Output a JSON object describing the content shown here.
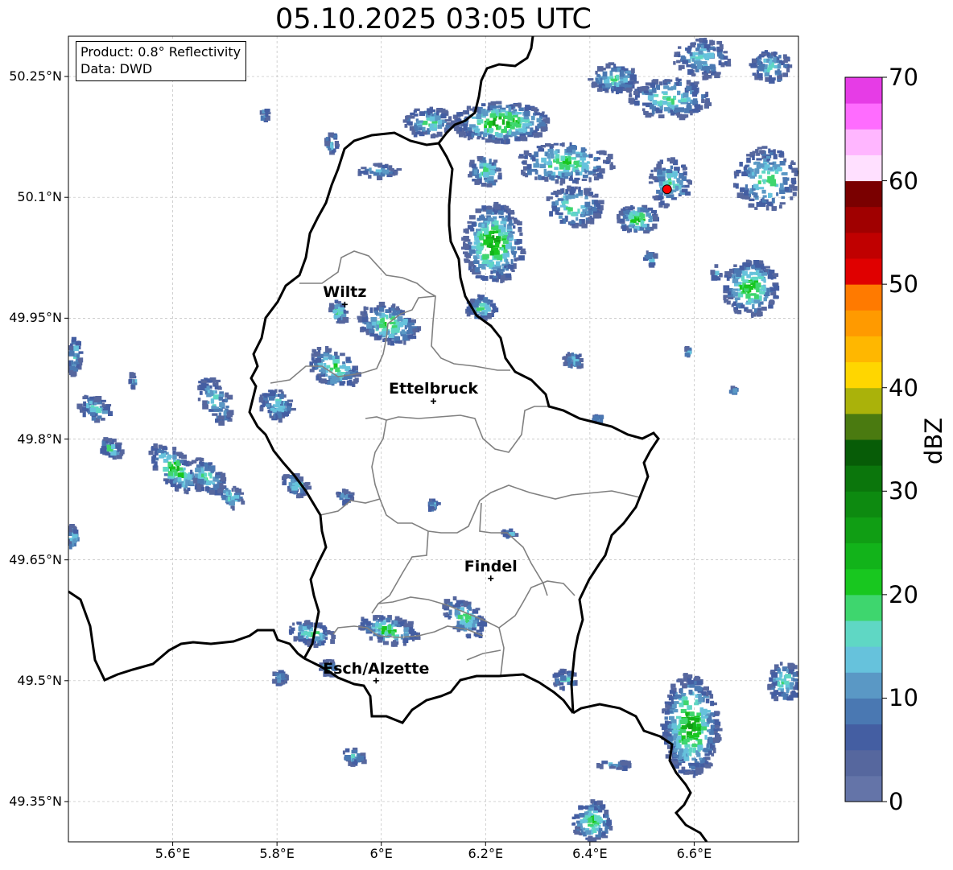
{
  "title": "05.10.2025 03:05 UTC",
  "info": {
    "product": "Product: 0.8° Reflectivity",
    "data": "Data: DWD"
  },
  "axes": {
    "lon_range": [
      5.4,
      6.8
    ],
    "lat_range": [
      49.3,
      50.3
    ],
    "lon_ticks": [
      {
        "value": 5.6,
        "label": "5.6°E"
      },
      {
        "value": 5.8,
        "label": "5.8°E"
      },
      {
        "value": 6.0,
        "label": "6°E"
      },
      {
        "value": 6.2,
        "label": "6.2°E"
      },
      {
        "value": 6.4,
        "label": "6.4°E"
      },
      {
        "value": 6.6,
        "label": "6.6°E"
      }
    ],
    "lat_ticks": [
      {
        "value": 50.25,
        "label": "50.25°N"
      },
      {
        "value": 50.1,
        "label": "50.1°N"
      },
      {
        "value": 49.95,
        "label": "49.95°N"
      },
      {
        "value": 49.8,
        "label": "49.8°N"
      },
      {
        "value": 49.65,
        "label": "49.65°N"
      },
      {
        "value": 49.5,
        "label": "49.5°N"
      },
      {
        "value": 49.35,
        "label": "49.35°N"
      }
    ],
    "grid": true
  },
  "cities": [
    {
      "name": "Wiltz",
      "lon": 5.93,
      "lat": 49.967
    },
    {
      "name": "Ettelbruck",
      "lon": 6.1,
      "lat": 49.847
    },
    {
      "name": "Findel",
      "lon": 6.21,
      "lat": 49.627
    },
    {
      "name": "Esch/Alzette",
      "lon": 5.99,
      "lat": 49.5
    }
  ],
  "radar_site": {
    "lon": 6.548,
    "lat": 50.11,
    "color": "#ff0000"
  },
  "colorbar": {
    "label": "dBZ",
    "min": 0,
    "max": 70,
    "ticks": [
      "0",
      "10",
      "20",
      "30",
      "40",
      "50",
      "60",
      "70"
    ],
    "colors": [
      "#6474a8",
      "#56679e",
      "#445ea2",
      "#4a78b2",
      "#5a98c5",
      "#66c2dc",
      "#5fd7c4",
      "#3ed66e",
      "#18c71f",
      "#12b31a",
      "#109e14",
      "#0d8a10",
      "#0b760c",
      "#075c07",
      "#4a7a10",
      "#aab20a",
      "#ffd600",
      "#ffb700",
      "#ff9a00",
      "#ff7a00",
      "#e00000",
      "#c00000",
      "#a00000",
      "#7a0000",
      "#ffe0ff",
      "#ffb6ff",
      "#ff6cff",
      "#e63ce6"
    ]
  },
  "chart_data": {
    "type": "heatmap",
    "title": "05.10.2025 03:05 UTC",
    "colorbar_label": "dBZ",
    "value_range": [
      0,
      70
    ],
    "echo_cells": [
      {
        "lon": 6.28,
        "lat": 50.21,
        "max_dbz": 25
      },
      {
        "lon": 6.2,
        "lat": 50.05,
        "max_dbz": 28
      },
      {
        "lon": 6.72,
        "lat": 49.99,
        "max_dbz": 25
      },
      {
        "lon": 5.98,
        "lat": 49.93,
        "max_dbz": 24
      },
      {
        "lon": 6.57,
        "lat": 49.39,
        "max_dbz": 25
      },
      {
        "lon": 5.62,
        "lat": 49.76,
        "max_dbz": 25
      },
      {
        "lon": 6.41,
        "lat": 49.3,
        "max_dbz": 20
      },
      {
        "lon": 6.5,
        "lat": 50.08,
        "max_dbz": 25
      }
    ]
  }
}
